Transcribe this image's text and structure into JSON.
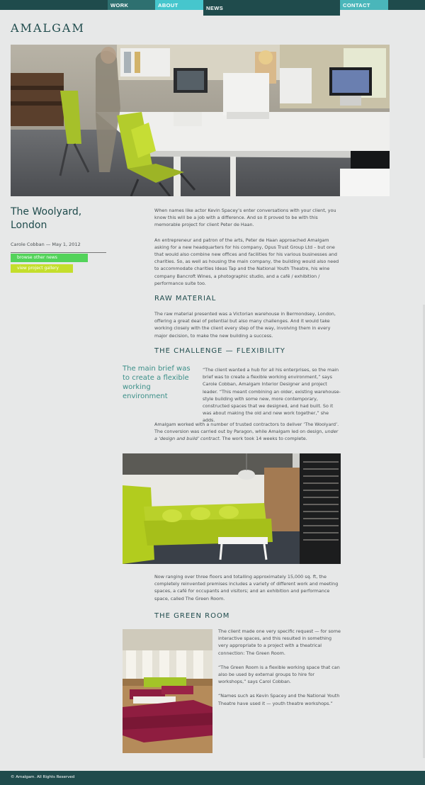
{
  "nav": {
    "work": "WORK",
    "about": "ABOUT",
    "news": "NEWS",
    "contact": "CONTACT"
  },
  "logo": "AMALGAM",
  "project": {
    "title": "The Woolyard, London",
    "byline": "Carole Cobban — May 1, 2012",
    "browse_button": "browse other news",
    "gallery_button": "view project gallery"
  },
  "article": {
    "p1": "When names like actor Kevin Spacey’s enter conversations with your client, you know this will be a job with a difference. And so it proved to be with this memorable project for client Peter de Haan.",
    "p2": "An entrepreneur and patron of the arts, Peter de Haan approached Amalgam asking for a new headquarters for his company, Opus Trust Group Ltd – but one that would also combine new offices and facilities for his various businesses and charities. So, as well as housing the main company, the building would also need to accommodate charities Ideas Tap and the National Youth Theatre, his wine company Bancroft Wines, a photographic studio, and a café / exhibition / performance suite too.",
    "h_raw": "RAW MATERIAL",
    "p3": "The raw material presented was a Victorian warehouse in Bermondsey, London, offering a great deal of potential but also many challenges. And it would take working closely with the client every step of the way, involving them in every major decision, to make the new building a success.",
    "h_challenge": "THE CHALLENGE — FLEXIBILITY",
    "pullquote": "The main brief was to create a flexible working environment",
    "p4": "“The client wanted a hub for all his enterprises, so the main brief was to create a flexible working environment,” says Carole Cobban, Amalgam Interior Designer and project leader. “This meant combining an older, existing warehouse-style building with some new, more contemporary, constructed spaces that we designed, and had built. So it was about making the old and new work together,” she adds.",
    "p5a": "Amalgam worked with a number of trusted contractors to deliver ‘The Woolyard’. The conversion was carried out by Paragon, while Amalgam led on design, ",
    "p5b": "under a ‘design and build’ contract",
    "p5c": ". The work took 14 weeks to complete.",
    "p6": "Now ranging over three floors and totalling approximately 15,000 sq. ft, the completely reinvented premises includes a variety of different work and meeting spaces, a café for occupants and visitors; and an exhibition and performance space, called The Green Room.",
    "h_green": "THE GREEN ROOM",
    "p7": "The client made one very specific request — for some interactive spaces, and this resulted in something very appropriate to a project with a theatrical connection: The Green Room.",
    "p8": "“The Green Room is a flexible working space that can also be used by external groups to hire for workshops,” says Carol Cobban.",
    "p9": "“Names such as Kevin Spacey and the National Youth Theatre have used it — youth theatre workshops.”"
  },
  "footer": "© Amalgam. All Rights Reserved",
  "colors": {
    "dark_teal": "#1f4b4c",
    "cyan": "#46c6cd",
    "green_button": "#53d35a",
    "lime_button": "#c4de2c"
  }
}
